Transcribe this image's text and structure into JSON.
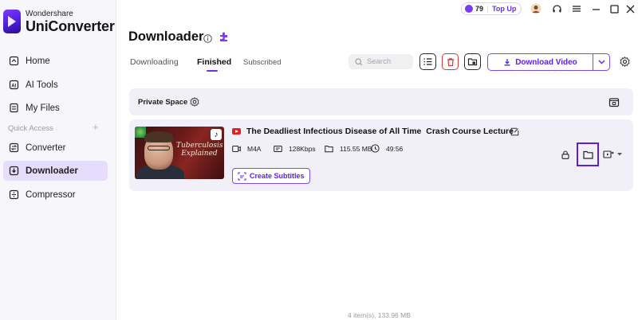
{
  "app": {
    "brand_small": "Wondershare",
    "brand_name": "UniConverter"
  },
  "sidebar": {
    "items": [
      {
        "label": "Home",
        "icon": "home-icon"
      },
      {
        "label": "AI Tools",
        "icon": "ai-tools-icon"
      },
      {
        "label": "My Files",
        "icon": "files-icon"
      }
    ],
    "quick_access_label": "Quick Access",
    "quick_items": [
      {
        "label": "Converter",
        "icon": "converter-icon"
      },
      {
        "label": "Downloader",
        "icon": "downloader-icon",
        "active": true
      },
      {
        "label": "Compressor",
        "icon": "compressor-icon"
      }
    ]
  },
  "topbar": {
    "credits": "79",
    "top_up_label": "Top Up"
  },
  "header": {
    "title": "Downloader",
    "tabs": [
      "Downloading",
      "Finished",
      "Subscribed"
    ],
    "active_tab": "Finished",
    "search_placeholder": "Search",
    "download_button_label": "Download Video"
  },
  "private_space": {
    "label": "Private Space"
  },
  "item": {
    "title": "The Deadliest Infectious Disease of All Time  Crash Course Lecture",
    "thumbnail_caption": "Tuberculosis Explained",
    "format": "M4A",
    "bitrate": "128Kbps",
    "size": "115.55 MB",
    "duration": "49:56",
    "create_subtitles_label": "Create Subtitles",
    "source": "YouTube"
  },
  "footer": {
    "status": "4 item(s), 133.96 MB"
  },
  "colors": {
    "accent": "#6a2ff0",
    "active_nav_bg": "#e6dcfb",
    "card_bg": "#f1eff8",
    "delete_red": "#d33a3a",
    "youtube_red": "#e21f1f"
  }
}
